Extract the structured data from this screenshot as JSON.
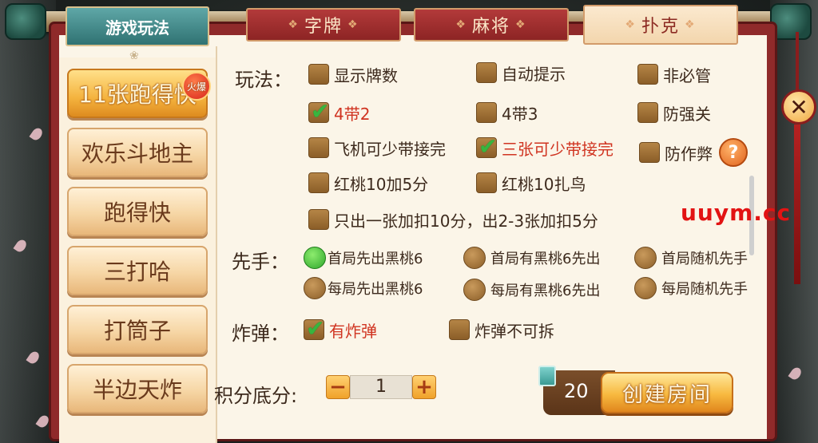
{
  "tabs": {
    "game_rules": "游戏玩法",
    "zipai": "字牌",
    "majiang": "麻将",
    "puke": "扑克"
  },
  "modes": [
    {
      "label": "11张跑得快",
      "badge": "火爆",
      "active": true
    },
    {
      "label": "欢乐斗地主"
    },
    {
      "label": "跑得快"
    },
    {
      "label": "三打哈"
    },
    {
      "label": "打筒子"
    },
    {
      "label": "半边天炸"
    }
  ],
  "rules": {
    "section_label": "玩法：",
    "options": [
      {
        "text": "显示牌数",
        "checked": false
      },
      {
        "text": "自动提示",
        "checked": false
      },
      {
        "text": "非必管",
        "checked": false
      },
      {
        "text": "4带2",
        "checked": true
      },
      {
        "text": "4带3",
        "checked": false
      },
      {
        "text": "防强关",
        "checked": false
      },
      {
        "text": "飞机可少带接完",
        "checked": false
      },
      {
        "text": "三张可少带接完",
        "checked": true
      },
      {
        "text": "防作弊",
        "checked": false
      },
      {
        "text": "红桃10加5分",
        "checked": false
      },
      {
        "text": "红桃10扎鸟",
        "checked": false
      },
      {
        "text": "只出一张加扣10分，出2-3张加扣5分",
        "checked": false
      }
    ],
    "help_symbol": "?"
  },
  "first_player": {
    "section_label": "先手：",
    "options": [
      {
        "text": "首局先出黑桃6",
        "selected": true
      },
      {
        "text": "首局有黑桃6先出",
        "selected": false
      },
      {
        "text": "首局随机先手",
        "selected": false
      },
      {
        "text": "每局先出黑桃6",
        "selected": false
      },
      {
        "text": "每局有黑桃6先出",
        "selected": false
      },
      {
        "text": "每局随机先手",
        "selected": false
      }
    ]
  },
  "bomb": {
    "section_label": "炸弹：",
    "options": [
      {
        "text": "有炸弹",
        "checked": true
      },
      {
        "text": "炸弹不可拆",
        "checked": false
      }
    ]
  },
  "score": {
    "label": "积分底分:",
    "value": "1",
    "minus": "−",
    "plus": "+"
  },
  "footer": {
    "cost": "20",
    "create_label": "创建房间"
  },
  "watermark": "uuym.cc",
  "close_symbol": "✕"
}
